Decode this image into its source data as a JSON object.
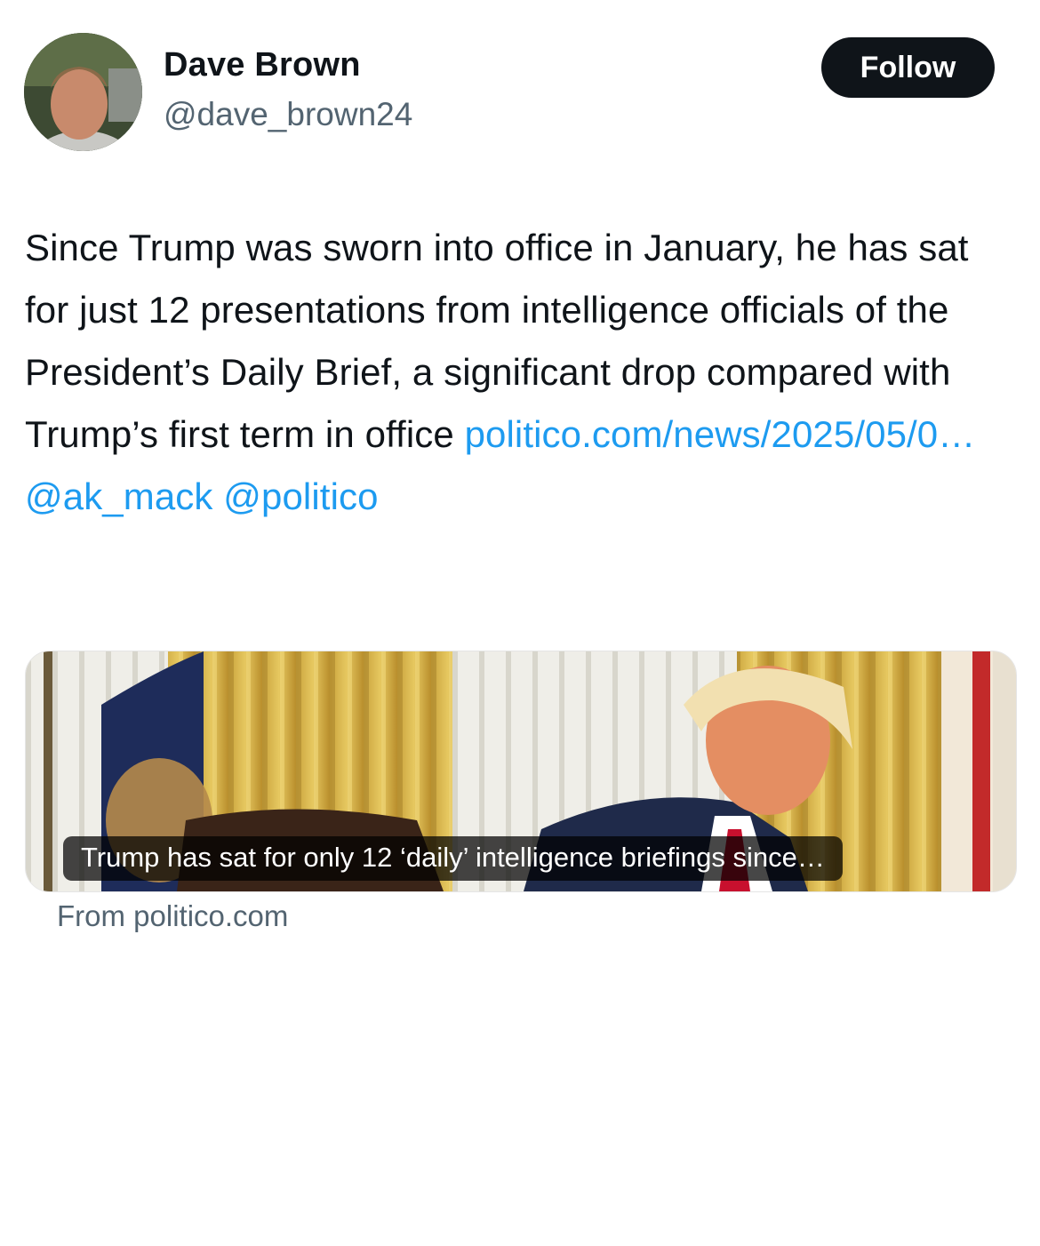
{
  "author": {
    "display_name": "Dave Brown",
    "handle": "@dave_brown24"
  },
  "follow_button": {
    "label": "Follow"
  },
  "tweet": {
    "text_before_link": "Since Trump was sworn into office in January, he has sat for just 12 presentations from intelligence officials of the President’s Daily Brief, a significant drop compared with Trump’s first term in office ",
    "link_text": "politico.com/news/2025/05/0…",
    "mention_1": "@ak_mack",
    "mention_2": "@politico"
  },
  "link_card": {
    "caption": "Trump has sat for only 12 ‘daily’ intelligence briefings since…",
    "source": "From politico.com"
  },
  "colors": {
    "text": "#0f1419",
    "secondary_text": "#536471",
    "link": "#1d9bf0",
    "follow_button_bg": "#0f1419"
  }
}
